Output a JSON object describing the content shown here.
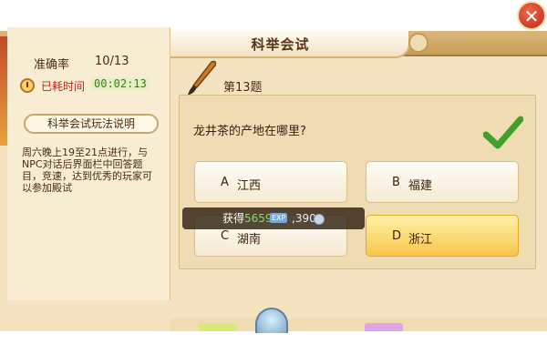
{
  "window": {
    "title": "科举会试",
    "close_symbol": "✕"
  },
  "stats": {
    "accuracy_label": "准确率",
    "accuracy_value": "10/13",
    "elapsed_label": "已耗时间",
    "elapsed_value": "00:02:13"
  },
  "rules": {
    "header": "科举会试玩法说明",
    "body": "周六晚上19至21点进行，与NPC对话后界面栏中回答题目，竞速，达到优秀的玩家可以参加殿试"
  },
  "question": {
    "number": "第13题",
    "text": "龙井茶的产地在哪里?",
    "options": [
      {
        "letter": "A",
        "text": "江西",
        "selected": false
      },
      {
        "letter": "B",
        "text": "福建",
        "selected": false
      },
      {
        "letter": "C",
        "text": "湖南",
        "selected": false
      },
      {
        "letter": "D",
        "text": "浙江",
        "selected": true
      }
    ]
  },
  "reward": {
    "label": "获得",
    "exp_value": "5659",
    "exp_badge": "EXP",
    "silver_value": ",390"
  },
  "colors": {
    "panel": "#f3e3c1",
    "accent_red": "#c0261a",
    "check_green": "#3fa02a",
    "selected_option": "#f7c64a"
  }
}
